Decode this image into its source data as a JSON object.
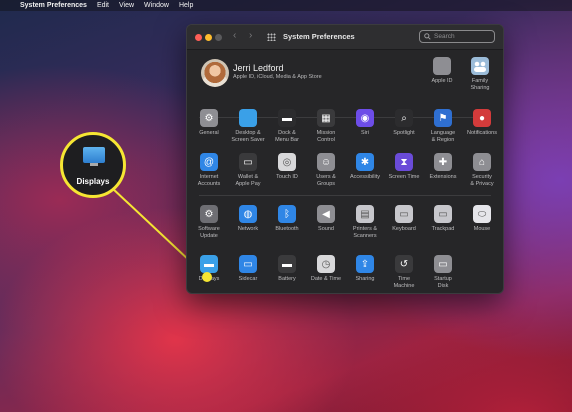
{
  "menubar": {
    "app_name": "System Preferences",
    "items": [
      "Edit",
      "View",
      "Window",
      "Help"
    ]
  },
  "window": {
    "title": "System Preferences",
    "search_placeholder": "Search"
  },
  "user": {
    "name": "Jerri Ledford",
    "subtitle": "Apple ID, iCloud, Media & App Store"
  },
  "top_items": [
    {
      "label": "Apple ID",
      "icon": "apple-icon"
    },
    {
      "label": "Family\nSharing",
      "icon": "family-icon"
    }
  ],
  "row1": [
    {
      "label": "General",
      "icon": "general-icon",
      "color": "#8e8e93"
    },
    {
      "label": "Desktop &\nScreen Saver",
      "icon": "desktop-icon",
      "color": "#3aa0e8"
    },
    {
      "label": "Dock &\nMenu Bar",
      "icon": "dock-icon",
      "color": "#2c2c2e"
    },
    {
      "label": "Mission\nControl",
      "icon": "mission-control-icon",
      "color": "#3a3a3c"
    },
    {
      "label": "Siri",
      "icon": "siri-icon",
      "color": "#6d4de8"
    },
    {
      "label": "Spotlight",
      "icon": "spotlight-icon",
      "color": "#2c2c2e"
    },
    {
      "label": "Language\n& Region",
      "icon": "globe-flag-icon",
      "color": "#2f6fd1"
    },
    {
      "label": "Notifications",
      "icon": "bell-icon",
      "color": "#d33b3b"
    }
  ],
  "row2": [
    {
      "label": "Internet\nAccounts",
      "icon": "at-icon",
      "color": "#2f86e6"
    },
    {
      "label": "Wallet &\nApple Pay",
      "icon": "wallet-icon",
      "color": "#3a3a3c"
    },
    {
      "label": "Touch ID",
      "icon": "fingerprint-icon",
      "color": "#d8d8da"
    },
    {
      "label": "Users &\nGroups",
      "icon": "users-icon",
      "color": "#8e8e93"
    },
    {
      "label": "Accessibility",
      "icon": "accessibility-icon",
      "color": "#2f86e6"
    },
    {
      "label": "Screen Time",
      "icon": "hourglass-icon",
      "color": "#6a4bd8"
    },
    {
      "label": "Extensions",
      "icon": "puzzle-icon",
      "color": "#8e8e93"
    },
    {
      "label": "Security\n& Privacy",
      "icon": "house-icon",
      "color": "#8e8e93"
    }
  ],
  "row3": [
    {
      "label": "Software\nUpdate",
      "icon": "gear-icon",
      "color": "#6e6e73"
    },
    {
      "label": "Network",
      "icon": "network-globe-icon",
      "color": "#2f86e6"
    },
    {
      "label": "Bluetooth",
      "icon": "bluetooth-icon",
      "color": "#2f86e6"
    },
    {
      "label": "Sound",
      "icon": "speaker-icon",
      "color": "#8e8e93"
    },
    {
      "label": "Printers &\nScanners",
      "icon": "printer-icon",
      "color": "#c7c7cc"
    },
    {
      "label": "Keyboard",
      "icon": "keyboard-icon",
      "color": "#c7c7cc"
    },
    {
      "label": "Trackpad",
      "icon": "trackpad-icon",
      "color": "#c7c7cc"
    },
    {
      "label": "Mouse",
      "icon": "mouse-icon",
      "color": "#e5e5ea"
    }
  ],
  "row4": [
    {
      "label": "Displays",
      "icon": "display-icon",
      "color": "#3aa0e8"
    },
    {
      "label": "Sidecar",
      "icon": "sidecar-icon",
      "color": "#2f86e6"
    },
    {
      "label": "Battery",
      "icon": "battery-icon",
      "color": "#3a3a3c"
    },
    {
      "label": "Date & Time",
      "icon": "clock-icon",
      "color": "#d8d8da"
    },
    {
      "label": "Sharing",
      "icon": "sharing-icon",
      "color": "#2f86e6"
    },
    {
      "label": "Time\nMachine",
      "icon": "time-machine-icon",
      "color": "#3a3a3c"
    },
    {
      "label": "Startup\nDisk",
      "icon": "disk-icon",
      "color": "#8e8e93"
    }
  ],
  "callout": {
    "label": "Displays",
    "accent": "#f6e633"
  }
}
